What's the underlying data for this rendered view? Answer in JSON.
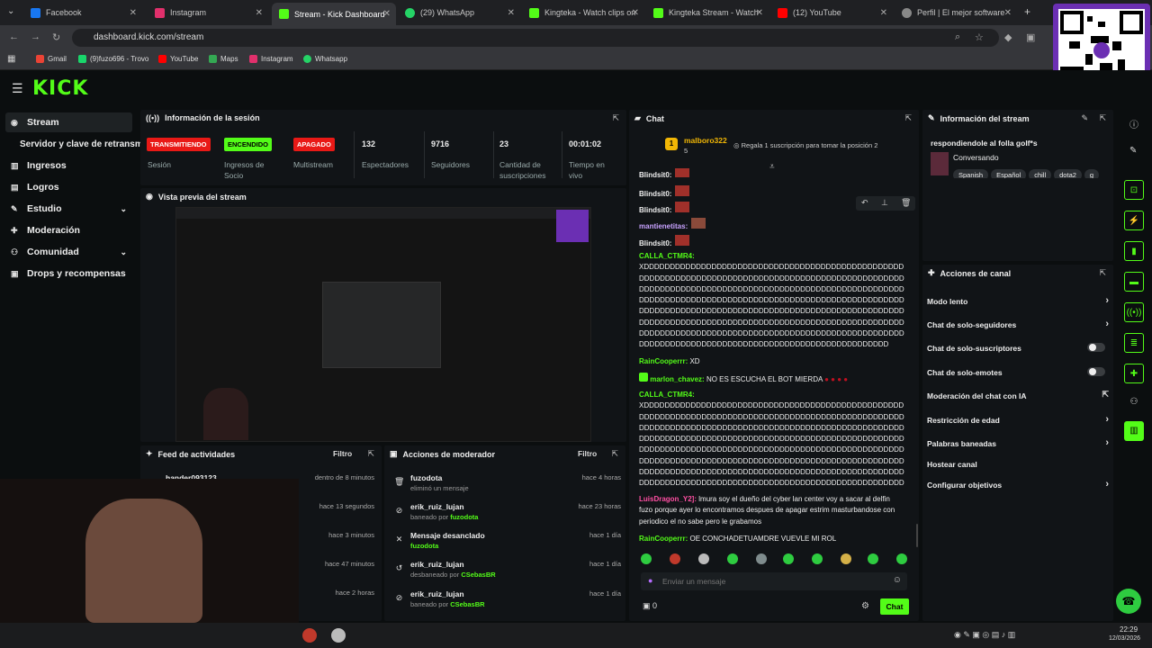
{
  "browser": {
    "tabs": [
      {
        "label": "Facebook",
        "color": "#1877f2"
      },
      {
        "label": "Instagram",
        "color": "#e1306c"
      },
      {
        "label": "Stream - Kick Dashboard",
        "color": "#53fc18"
      },
      {
        "label": "(29) WhatsApp",
        "color": "#25d366"
      },
      {
        "label": "Kingteka - Watch clips on",
        "color": "#53fc18"
      },
      {
        "label": "Kingteka Stream - Watch",
        "color": "#53fc18"
      },
      {
        "label": "(12) YouTube",
        "color": "#ff0000"
      },
      {
        "label": "Perfil | El mejor software",
        "color": "#888888"
      }
    ],
    "url": "dashboard.kick.com/stream",
    "bookmarks": [
      "Gmail",
      "(9)fuzo696 - Trovo",
      "YouTube",
      "Maps",
      "Instagram",
      "Whatsapp"
    ]
  },
  "brand": {
    "logo": "KICK",
    "accent": "#53fc18"
  },
  "sidebar": {
    "items": [
      {
        "label": "Stream",
        "icon": "broadcast-icon"
      },
      {
        "label": "Servidor y clave de retransmi",
        "icon": ""
      },
      {
        "label": "Ingresos",
        "icon": "chart-icon"
      },
      {
        "label": "Logros",
        "icon": "trophy-icon"
      },
      {
        "label": "Estudio",
        "icon": "studio-icon"
      },
      {
        "label": "Moderación",
        "icon": "wrench-icon"
      },
      {
        "label": "Comunidad",
        "icon": "people-icon"
      },
      {
        "label": "Drops y recompensas",
        "icon": "gift-icon"
      }
    ]
  },
  "session": {
    "title": "Información de la sesión",
    "badges": [
      {
        "text": "TRANSMITIENDO",
        "label": "Sesión",
        "color": "#e91916"
      },
      {
        "text": "ENCENDIDO",
        "label": "Ingresos de Socio",
        "color": "#53fc18"
      },
      {
        "text": "APAGADO",
        "label": "Multistream",
        "color": "#e91916"
      }
    ],
    "stats": [
      {
        "value": "132",
        "label": "Espectadores"
      },
      {
        "value": "9716",
        "label": "Seguidores"
      },
      {
        "value": "23",
        "label": "Cantidad de suscripciones"
      },
      {
        "value": "00:01:02",
        "label": "Tiempo en vivo"
      }
    ]
  },
  "preview": {
    "title": "Vista previa del stream"
  },
  "activity": {
    "title": "Feed de actividades",
    "filter": "Filtro",
    "items": [
      {
        "name": "hander093123",
        "time": "dentro de 8 minutos"
      },
      {
        "name": "",
        "time": "hace 13 segundos"
      },
      {
        "name": "",
        "time": "hace 3 minutos"
      },
      {
        "name": "",
        "time": "hace 47 minutos"
      },
      {
        "name": "",
        "time": "hace 2 horas"
      }
    ]
  },
  "modactions": {
    "title": "Acciones de moderador",
    "filter": "Filtro",
    "items": [
      {
        "name": "fuzodota",
        "sub": "eliminó un mensaje",
        "by": "",
        "time": "hace 4 horas",
        "icon": "trash-icon"
      },
      {
        "name": "erik_ruiz_lujan",
        "sub": "baneado por",
        "by": "fuzodota",
        "time": "hace 23 horas",
        "icon": "ban-icon"
      },
      {
        "name": "Mensaje desanclado",
        "sub": "",
        "by": "fuzodota",
        "time": "hace 1 día",
        "icon": "unpin-icon"
      },
      {
        "name": "erik_ruiz_lujan",
        "sub": "desbaneado por",
        "by": "CSebasBR",
        "time": "hace 1 día",
        "icon": "undo-icon"
      },
      {
        "name": "erik_ruiz_lujan",
        "sub": "baneado por",
        "by": "CSebasBR",
        "time": "hace 1 día",
        "icon": "ban-icon"
      }
    ]
  },
  "chat": {
    "title": "Chat",
    "top_gifter": {
      "rank": "1",
      "name": "malboro322",
      "count": "5"
    },
    "gift_cta": "Regala 1 suscripción para tomar la posición 2",
    "messages": [
      {
        "user": "Blindsit0:",
        "text": "",
        "color": "#eeeeee"
      },
      {
        "user": "Blindsit0:",
        "text": "",
        "color": "#eeeeee"
      },
      {
        "user": "Blindsit0:",
        "text": "",
        "color": "#eeeeee"
      },
      {
        "user": "mantienetitas:",
        "text": "",
        "color": "#c8a2ff"
      },
      {
        "user": "Blindsit0:",
        "text": "",
        "color": "#eeeeee"
      },
      {
        "user": "CALLA_CTMR4:",
        "text": "XDDDDDDDDDDDDDDDDDDDDDDDDDDDDDDDDDDDDDDDDDDDDDDDDDDDDDDDDDDDDDDDDDDDDDDDDDDDDDDDDDDDDDDDDDDDDDDDDDDDDDDDDDDDDDDDDDDDDDDDDDDDDDDDDDDDDDDDDDDDDDDDDDDDDDDDDDDDDDDDDDDDDDDDDDDDDDDDDDDDDDDDDDDDDDDDDDDDDDDDDDDDDDDDDDDDDDDDDDDDDDDDDDDDDDDDDDDDDDDDDDDDDDDDDDDDDDDDDDDDDDDDDDDDDDDDDDDDDDDDDDDDDDDDDDDDDDDDDDDDDDDDDDDDDDDDDDDDDDDDDDDDDDDDDDDDDDDDDDDDDDDDDDDDDDDDDDDDDDDDDDDDDDDDDDDDDDDDDDDDDDDDDDDDDDDDDDDDDDDDDDDDD",
        "color": "#53fc18"
      },
      {
        "user": "RainCooperrr:",
        "text": "XD",
        "color": "#53fc18"
      },
      {
        "user": "marlon_chavez:",
        "text": "NO ES ESCUCHA EL BOT MIERDA",
        "color": "#53fc18"
      },
      {
        "user": "CALLA_CTMR4:",
        "text": "XDDDDDDDDDDDDDDDDDDDDDDDDDDDDDDDDDDDDDDDDDDDDDDDDDDDDDDDDDDDDDDDDDDDDDDDDDDDDDDDDDDDDDDDDDDDDDDDDDDDDDDDDDDDDDDDDDDDDDDDDDDDDDDDDDDDDDDDDDDDDDDDDDDDDDDDDDDDDDDDDDDDDDDDDDDDDDDDDDDDDDDDDDDDDDDDDDDDDDDDDDDDDDDDDDDDDDDDDDDDDDDDDDDDDDDDDDDDDDDDDDDDDDDDDDDDDDDDDDDDDDDDDDDDDDDDDDDDDDDDDDDDDDDDDDDDDDDDDDDDDDDDDDDDDDDDDDDDDDDDDDDDDDDDDDDDDDDDDDDDDDDDDDDDDDDDDDDDDDDDDDDDDDDDDDDDDDDDDDDDDDDDDDDDDDDDDDDDDDDDDDDDDDDDDDDDDDDDDDDDDDDDDDDDDDDDDDDDDDDDDDDDDDDDDDDDDDDDDDD",
        "color": "#53fc18"
      },
      {
        "user": "LuisDragon_Y2]:",
        "text": "lmura soy el dueño del cyber lan center voy a sacar al delfin fuzo porque ayer lo encontramos despues de apagar estrim masturbandose con periodico el no sabe pero le grabamos",
        "color": "#ff4fa3"
      },
      {
        "user": "RainCooperrr:",
        "text": "OE CONCHADETUAMDRE VUEVLE MI ROL",
        "color": "#53fc18"
      }
    ],
    "input_placeholder": "Enviar un mensaje",
    "points": "0",
    "send_label": "Chat"
  },
  "stream_info": {
    "title": "Información del stream",
    "stream_title": "respondiendole al folla golf*s",
    "category": "Conversando",
    "tags": [
      "Spanish",
      "Español",
      "chill",
      "dota2",
      "g"
    ]
  },
  "channel_actions": {
    "title": "Acciones de canal",
    "items": [
      {
        "label": "Modo lento",
        "control": "chevron"
      },
      {
        "label": "Chat de solo-seguidores",
        "control": "chevron"
      },
      {
        "label": "Chat de solo-suscriptores",
        "control": "toggle"
      },
      {
        "label": "Chat de solo-emotes",
        "control": "toggle"
      },
      {
        "label": "Moderación del chat con IA",
        "control": "external"
      },
      {
        "label": "Restricción de edad",
        "control": "chevron"
      },
      {
        "label": "Palabras baneadas",
        "control": "chevron"
      },
      {
        "label": "Hostear canal",
        "control": "none"
      },
      {
        "label": "Configurar objetivos",
        "control": "chevron"
      }
    ]
  },
  "taskbar": {
    "time": "22:29",
    "date": "12/03/2026"
  }
}
